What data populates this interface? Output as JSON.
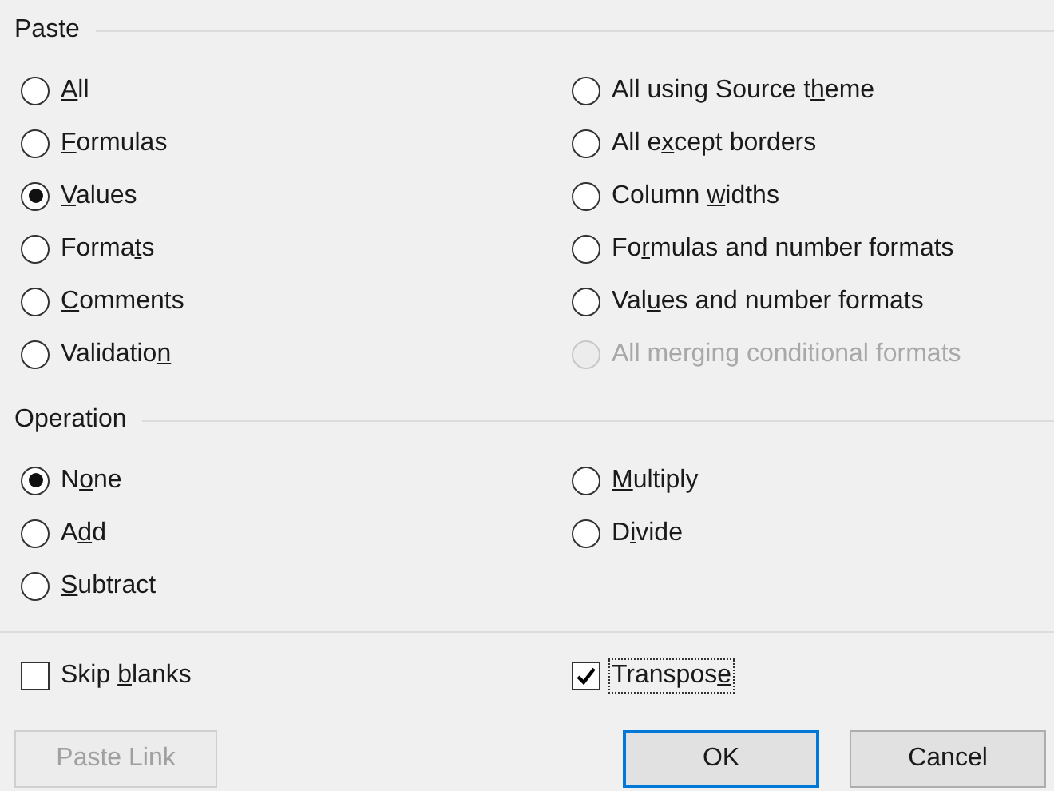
{
  "paste": {
    "title": "Paste",
    "columns": [
      [
        {
          "key": "A",
          "post": "ll",
          "selected": false,
          "disabled": false
        },
        {
          "key": "F",
          "post": "ormulas",
          "selected": false,
          "disabled": false
        },
        {
          "key": "V",
          "post": "alues",
          "selected": true,
          "disabled": false
        },
        {
          "pre": "Forma",
          "key": "t",
          "post": "s",
          "selected": false,
          "disabled": false
        },
        {
          "key": "C",
          "post": "omments",
          "selected": false,
          "disabled": false
        },
        {
          "pre": "Validatio",
          "key": "n",
          "selected": false,
          "disabled": false
        }
      ],
      [
        {
          "pre": "All using Source t",
          "key": "h",
          "post": "eme",
          "selected": false,
          "disabled": false
        },
        {
          "pre": "All e",
          "key": "x",
          "post": "cept borders",
          "selected": false,
          "disabled": false
        },
        {
          "pre": "Column ",
          "key": "w",
          "post": "idths",
          "selected": false,
          "disabled": false
        },
        {
          "pre": "Fo",
          "key": "r",
          "post": "mulas and number formats",
          "selected": false,
          "disabled": false
        },
        {
          "pre": "Val",
          "key": "u",
          "post": "es and number formats",
          "selected": false,
          "disabled": false
        },
        {
          "pre": "All merging conditional formats",
          "selected": false,
          "disabled": true
        }
      ]
    ]
  },
  "operation": {
    "title": "Operation",
    "columns": [
      [
        {
          "pre": "N",
          "key": "o",
          "post": "ne",
          "selected": true,
          "disabled": false
        },
        {
          "pre": "A",
          "key": "d",
          "post": "d",
          "selected": false,
          "disabled": false
        },
        {
          "key": "S",
          "post": "ubtract",
          "selected": false,
          "disabled": false
        }
      ],
      [
        {
          "key": "M",
          "post": "ultiply",
          "selected": false,
          "disabled": false
        },
        {
          "pre": "D",
          "key": "i",
          "post": "vide",
          "selected": false,
          "disabled": false
        }
      ]
    ]
  },
  "checkboxes": [
    {
      "pre": "Skip ",
      "key": "b",
      "post": "lanks",
      "checked": false,
      "focused": false
    },
    {
      "pre": "Transpos",
      "key": "e",
      "checked": true,
      "focused": true
    }
  ],
  "buttons": [
    {
      "label": "Paste Link",
      "disabled": true,
      "default": false
    },
    {
      "label": "OK",
      "disabled": false,
      "default": true
    },
    {
      "label": "Cancel",
      "disabled": false,
      "default": false
    }
  ]
}
